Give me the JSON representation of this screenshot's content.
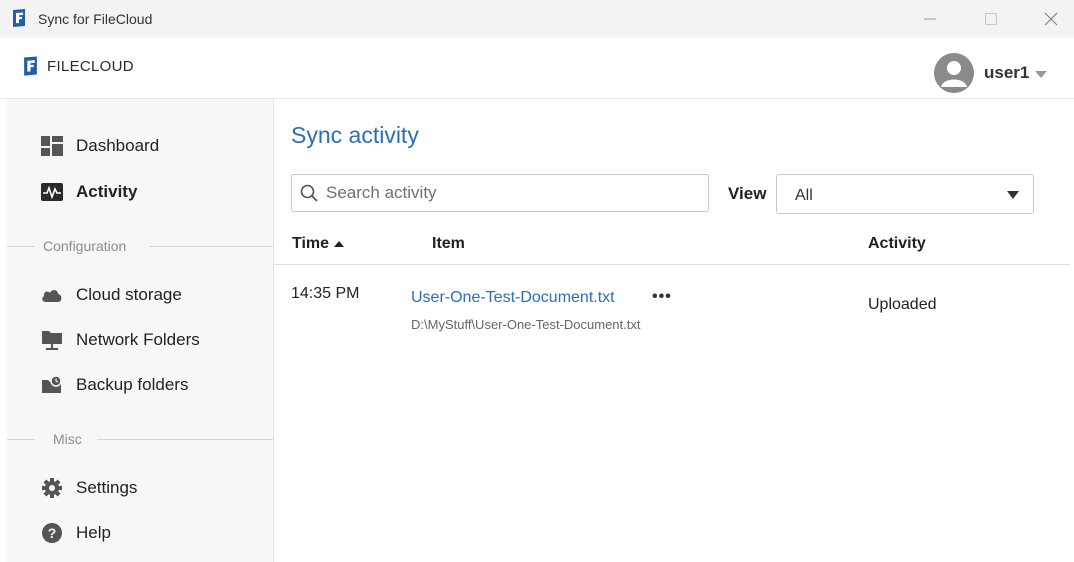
{
  "window": {
    "title": "Sync for FileCloud"
  },
  "header": {
    "logo_text": "FILECLOUD",
    "user_name": "user1"
  },
  "sidebar": {
    "items": [
      {
        "label": "Dashboard",
        "icon": "dashboard-icon"
      },
      {
        "label": "Activity",
        "icon": "activity-icon",
        "active": true
      }
    ],
    "sections": [
      {
        "title": "Configuration",
        "items": [
          {
            "label": "Cloud storage",
            "icon": "cloud-icon"
          },
          {
            "label": "Network Folders",
            "icon": "network-folder-icon"
          },
          {
            "label": "Backup folders",
            "icon": "backup-folder-icon"
          }
        ]
      },
      {
        "title": "Misc",
        "items": [
          {
            "label": "Settings",
            "icon": "gear-icon"
          },
          {
            "label": "Help",
            "icon": "help-icon"
          }
        ]
      }
    ]
  },
  "main": {
    "title": "Sync activity",
    "search": {
      "placeholder": "Search activity",
      "value": ""
    },
    "view": {
      "label": "View",
      "selected": "All"
    },
    "table": {
      "columns": [
        "Time",
        "Item",
        "Activity"
      ],
      "sort_column": "Time",
      "sort_direction": "ascending",
      "rows": [
        {
          "time": "14:35 PM",
          "item_name": "User-One-Test-Document.txt",
          "more": "•••",
          "item_path": "D:\\MyStuff\\User-One-Test-Document.txt",
          "activity": "Uploaded"
        }
      ]
    }
  },
  "colors": {
    "accent": "#2a6fb5",
    "sidebar_bg": "#f7f7f7",
    "titlebar_bg": "#f3f3f3"
  }
}
